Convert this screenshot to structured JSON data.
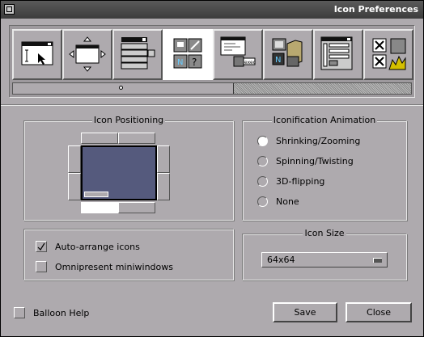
{
  "window": {
    "title": "Icon Preferences"
  },
  "toolbar": {
    "tools": [
      {
        "name": "appearance-tool",
        "icon": "window-cursor-icon",
        "selected": false
      },
      {
        "name": "window-handling-tool",
        "icon": "window-move-icon",
        "selected": false
      },
      {
        "name": "menu-tool",
        "icon": "menu-icon",
        "selected": false
      },
      {
        "name": "icon-tool",
        "icon": "icons-icon",
        "selected": true
      },
      {
        "name": "miniwindow-tool",
        "icon": "exec-icon",
        "selected": false
      },
      {
        "name": "workspace-tool",
        "icon": "folder-icon",
        "selected": false
      },
      {
        "name": "paths-tool",
        "icon": "search-path-icon",
        "selected": false
      },
      {
        "name": "expert-tool",
        "icon": "expert-icon",
        "selected": false
      }
    ]
  },
  "icon_positioning": {
    "title": "Icon Positioning",
    "selected": "bottom-left"
  },
  "iconification": {
    "title": "Iconification Animation",
    "options": [
      "Shrinking/Zooming",
      "Spinning/Twisting",
      "3D-flipping",
      "None"
    ],
    "selected_index": 0
  },
  "options": {
    "auto_arrange": {
      "label": "Auto-arrange icons",
      "checked": true
    },
    "omnipresent": {
      "label": "Omnipresent miniwindows",
      "checked": false
    }
  },
  "icon_size": {
    "title": "Icon Size",
    "value": "64x64"
  },
  "footer": {
    "balloon_help": {
      "label": "Balloon Help",
      "checked": false
    },
    "save_label": "Save",
    "close_label": "Close"
  }
}
